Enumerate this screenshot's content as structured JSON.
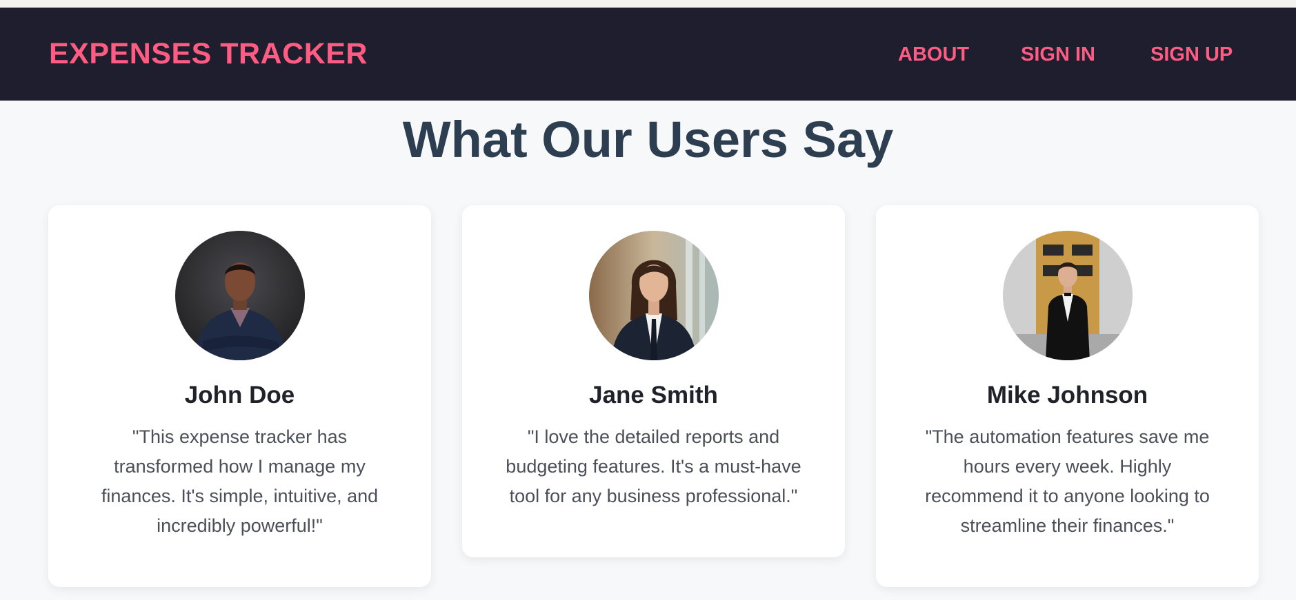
{
  "header": {
    "brand": "EXPENSES TRACKER",
    "nav": [
      {
        "label": "ABOUT"
      },
      {
        "label": "SIGN IN"
      },
      {
        "label": "SIGN UP"
      }
    ]
  },
  "testimonials": {
    "title": "What Our Users Say",
    "items": [
      {
        "name": "John Doe",
        "quote": "\"This expense tracker has transformed how I manage my finances. It's simple, intuitive, and incredibly powerful!\""
      },
      {
        "name": "Jane Smith",
        "quote": "\"I love the detailed reports and budgeting features. It's a must-have tool for any business professional.\""
      },
      {
        "name": "Mike Johnson",
        "quote": "\"The automation features save me hours every week. Highly recommend it to anyone looking to streamline their finances.\""
      }
    ]
  },
  "colors": {
    "navbar_bg": "#1f1e2f",
    "accent": "#ff5c84",
    "title": "#2c3e50",
    "page_bg": "#f6f8fa",
    "card_bg": "#ffffff"
  }
}
